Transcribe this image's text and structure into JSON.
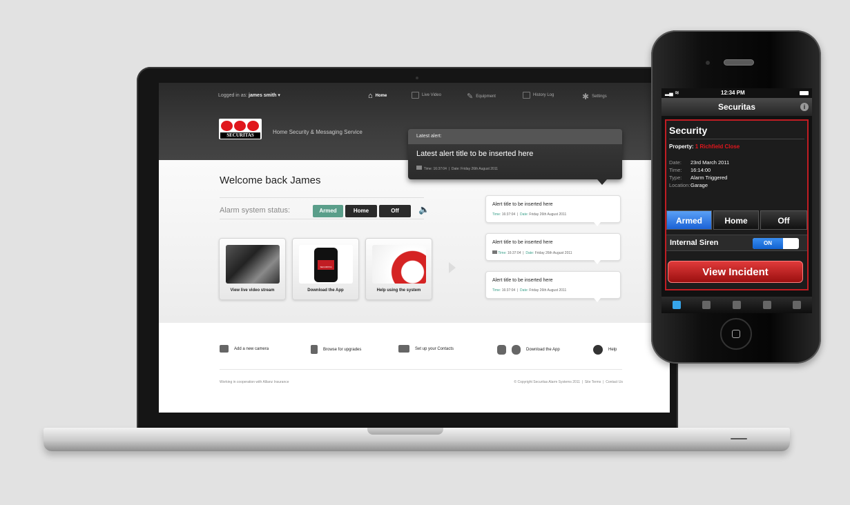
{
  "web": {
    "nav": {
      "logged_in": "Logged in as:",
      "user": "james smith",
      "items": [
        "Home",
        "Live Video",
        "Equipment",
        "History Log",
        "Settings"
      ]
    },
    "brand": {
      "logo_text": "SECURITAS",
      "tagline": "Home Security & Messaging Service"
    },
    "latest_alert": {
      "header": "Latest alert:",
      "title": "Latest alert title to be inserted here",
      "time_label": "Time:",
      "time": "16:37:04",
      "date_label": "Date:",
      "date": "Friday 26th August 2011"
    },
    "welcome": "Welcome back James",
    "alarm": {
      "label": "Alarm system status:",
      "options": [
        "Armed",
        "Home",
        "Off"
      ],
      "active": "Armed"
    },
    "cards": [
      {
        "label": "View live video stream"
      },
      {
        "label": "Download the App",
        "screen_text": "SECURITAS"
      },
      {
        "label": "Help using the system"
      }
    ],
    "alerts": [
      {
        "title": "Alert title to be inserted here",
        "time_label": "Time:",
        "time": "16:37:04",
        "date_label": "Date:",
        "date": "Friday 26th August 2011"
      },
      {
        "title": "Alert title to be inserted here",
        "time_label": "Time:",
        "time": "16:37:04",
        "date_label": "Date:",
        "date": "Friday 26th August 2011"
      },
      {
        "title": "Alert title to be inserted here",
        "time_label": "Time:",
        "time": "16:37:04",
        "date_label": "Date:",
        "date": "Friday 26th August 2011"
      }
    ],
    "footer": {
      "links": [
        "Add a new camera",
        "Browse for upgrades",
        "Set up your Contacts",
        "Download the App",
        "Help"
      ],
      "cooperation": "Working in cooperation with Allianz Insurance",
      "copyright": "© Copyright Securitas Alarm Systems 2011",
      "site_terms": "Site Terms",
      "contact": "Contact Us",
      "separator": "|"
    }
  },
  "phone": {
    "status": {
      "time": "12:34 PM"
    },
    "title": "Securitas",
    "section": "Security",
    "property_label": "Property:",
    "property_value": "1 Richfield Close",
    "details": [
      {
        "k": "Date:",
        "v": "23rd March 2011"
      },
      {
        "k": "Time:",
        "v": "16:14:00"
      },
      {
        "k": "Type:",
        "v": "Alarm Triggered"
      },
      {
        "k": "Location:",
        "v": "Garage"
      }
    ],
    "modes": [
      "Armed",
      "Home",
      "Off"
    ],
    "active_mode": "Armed",
    "siren_label": "Internal Siren",
    "siren_state": "ON",
    "view_button": "View Incident",
    "tabs": [
      "lock-icon",
      "video-icon",
      "pulse-icon",
      "list-icon",
      "gear-icon"
    ]
  },
  "colors": {
    "brand_red": "#e0161c",
    "armed_green": "#5a9e8a",
    "ios_blue": "#1a73e8",
    "incident_red": "#b81c1c"
  }
}
